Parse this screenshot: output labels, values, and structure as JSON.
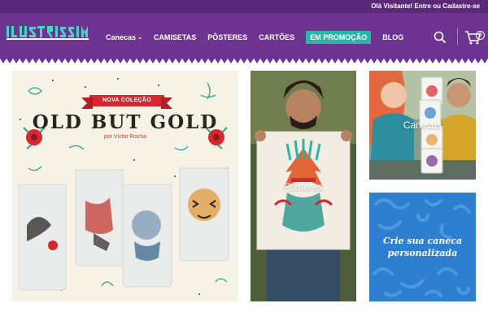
{
  "topbar": {
    "login_text": "Olá Visitante! Entre ou Cadastre-se"
  },
  "header": {
    "logo_alt": "ILUSTRISSIMA",
    "nav": [
      {
        "label": "Canecas",
        "has_dropdown": true
      },
      {
        "label": "CAMISETAS"
      },
      {
        "label": "PÔSTERES"
      },
      {
        "label": "CARTÕES"
      },
      {
        "label": "EM PROMOÇÃO",
        "highlight": true
      },
      {
        "label": "BLOG"
      }
    ],
    "cart_count": "0"
  },
  "banner": {
    "ribbon": "NOVA COLEÇÃO",
    "title": "OLD BUT GOLD",
    "author": "por Victor Rocha"
  },
  "tiles": {
    "posters": "Pôsteres",
    "canecas": "Canecas",
    "crie_line1": "Crie sua caneca",
    "crie_line2": "personalizada"
  },
  "colors": {
    "topbar": "#5a2a78",
    "header": "#6e3492",
    "promo": "#2bb5a8",
    "crie_bg": "#2f7fd0",
    "ribbon": "#d6262f"
  },
  "icons": [
    "search-icon",
    "cart-icon",
    "chevron-down-icon"
  ]
}
